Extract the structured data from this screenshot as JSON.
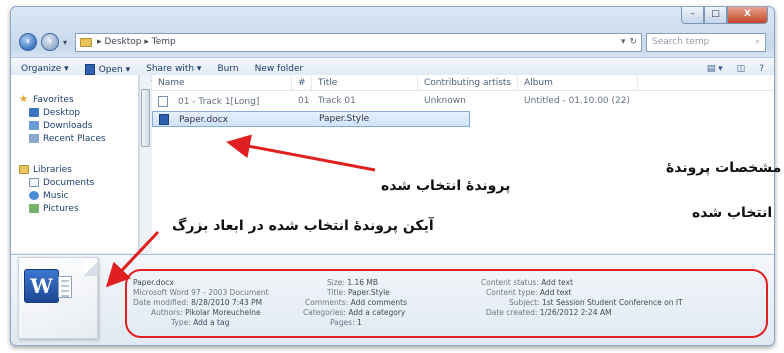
{
  "window": {
    "controls": {
      "minimize": "–",
      "maximize": "□",
      "close": "X"
    }
  },
  "address": {
    "path": "▸ Desktop ▸ Temp",
    "search_placeholder": "Search temp",
    "refresh": "↻"
  },
  "toolbar": {
    "organize": "Organize ▾",
    "open": "Open ▾",
    "share_with": "Share with ▾",
    "burn": "Burn",
    "new_folder": "New folder",
    "views": "▤ ▾",
    "preview": "◫",
    "help": "?"
  },
  "nav_pane": {
    "favorites": "Favorites",
    "desktop": "Desktop",
    "downloads": "Downloads",
    "recent": "Recent Places",
    "libraries": "Libraries",
    "documents": "Documents",
    "music": "Music",
    "pictures": "Pictures"
  },
  "columns": {
    "name": "Name",
    "number": "#",
    "title": "Title",
    "artist": "Contributing artists",
    "album": "Album"
  },
  "files": [
    {
      "name": "01 - Track 1[Long]",
      "number": "01",
      "title": "Track 01",
      "artist": "Unknown",
      "album": "Untitled - 01.10.00 (22)"
    },
    {
      "name": "Paper.docx",
      "number": "",
      "title": "Paper.Style",
      "artist": "",
      "album": ""
    }
  ],
  "details": {
    "file_name": "Paper.docx",
    "file_type": "Microsoft Word 97 - 2003 Document",
    "date_modified_label": "Date modified:",
    "date_modified": "8/28/2010 7:43 PM",
    "authors_label": "Authors:",
    "authors": "Pikolar Moreuchelne",
    "type_label": "Type:",
    "type_value": "Add a tag",
    "size_label": "Size:",
    "size": "1.16 MB",
    "title_label": "Title:",
    "title": "Paper.Style",
    "comments_label": "Comments:",
    "comments": "Add comments",
    "categories_label": "Categories:",
    "categories": "Add a category",
    "pages_label": "Pages:",
    "pages": "1",
    "content_status_label": "Content status:",
    "content_status": "Add text",
    "content_type_label": "Content type:",
    "content_type": "Add text",
    "subject_label": "Subject:",
    "subject": "1st Session Student Conference on IT",
    "date_created_label": "Date created:",
    "date_created": "1/26/2012 2:24 AM"
  },
  "annotations": {
    "selected_file": "پروندهٔ انتخاب شده",
    "large_icon": "آیکن پروندهٔ انتخاب شده در ابعاد بزرگ",
    "properties_line1": "مشخصات پروندهٔ",
    "properties_line2": "انتخاب شده"
  },
  "colors": {
    "annotation_red": "#e02020",
    "selection": "#cfe3f9"
  }
}
